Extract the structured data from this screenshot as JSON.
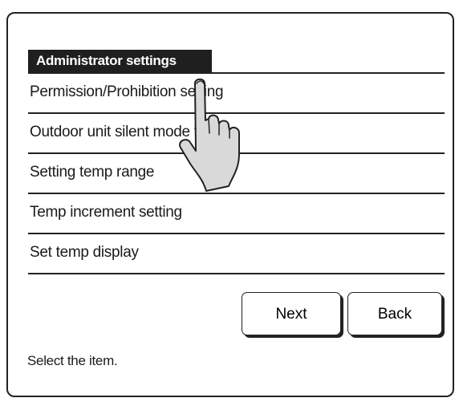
{
  "screen": {
    "title": "Administrator settings",
    "menu_items": [
      {
        "label": "Permission/Prohibition setting"
      },
      {
        "label": "Outdoor unit silent mode timer"
      },
      {
        "label": "Setting temp range"
      },
      {
        "label": "Temp increment setting"
      },
      {
        "label": "Set temp display"
      }
    ],
    "buttons": {
      "next_label": "Next",
      "back_label": "Back"
    },
    "status_text": "Select the item.",
    "pointer_icon": "pointing-hand-icon"
  }
}
